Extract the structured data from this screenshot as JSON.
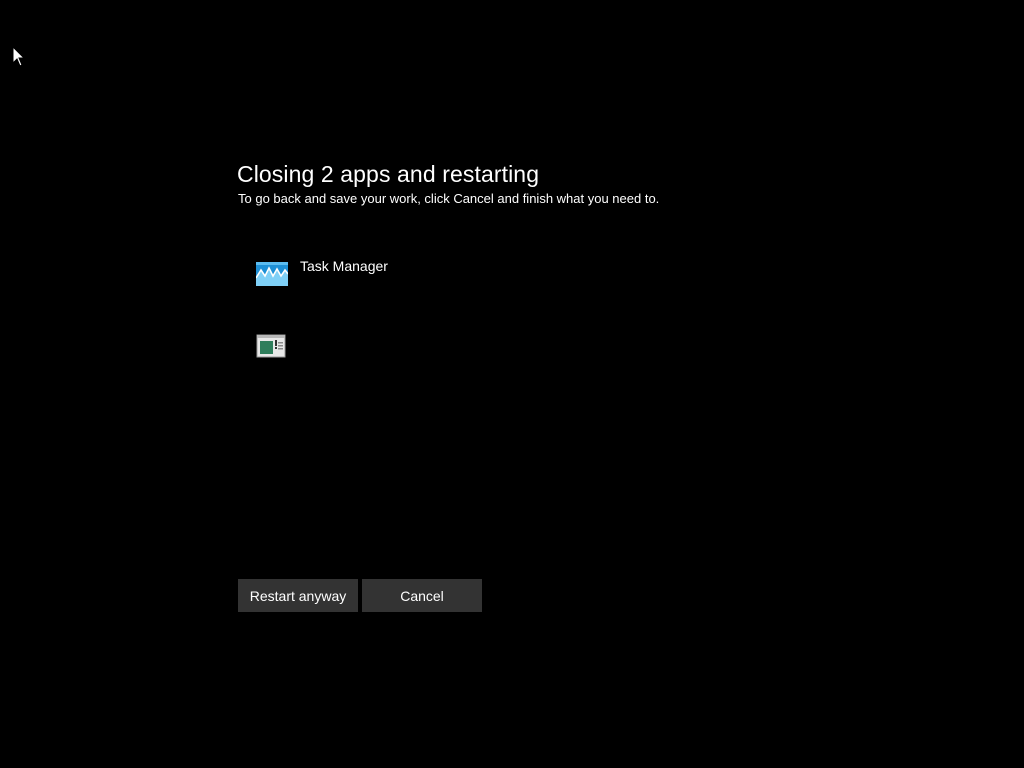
{
  "dialog": {
    "title": "Closing 2 apps and restarting",
    "subtitle": "To go back and save your work, click Cancel and finish what you need to."
  },
  "apps": [
    {
      "name": "Task Manager",
      "icon": "task-manager-icon"
    },
    {
      "name": "",
      "icon": "app-window-icon"
    }
  ],
  "buttons": {
    "restart_label": "Restart anyway",
    "cancel_label": "Cancel"
  },
  "colors": {
    "background": "#000000",
    "text": "#ffffff",
    "button_bg": "#333333"
  }
}
